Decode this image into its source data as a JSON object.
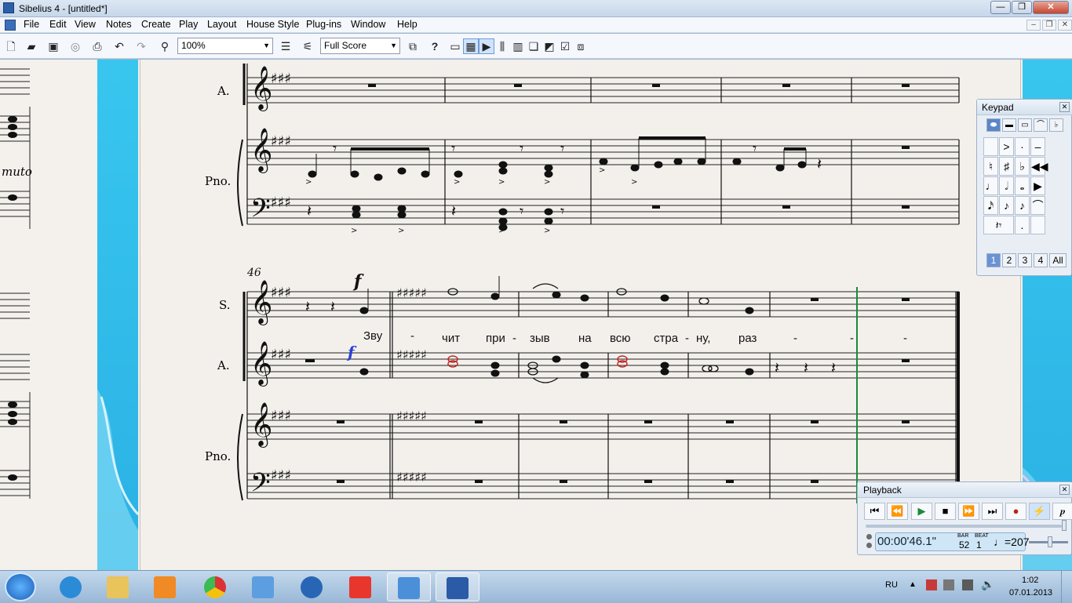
{
  "window": {
    "title": "Sibelius 4 - [untitled*]",
    "min": "—",
    "max": "❐",
    "close": "✕"
  },
  "menu": [
    "File",
    "Edit",
    "View",
    "Notes",
    "Create",
    "Play",
    "Layout",
    "House Style",
    "Plug-ins",
    "Window",
    "Help"
  ],
  "mdi": {
    "min": "–",
    "restore": "❐",
    "close": "✕"
  },
  "toolbar": {
    "zoom": "100%",
    "score_view": "Full Score",
    "help": "?"
  },
  "score": {
    "bar_number": "46",
    "staff_names": {
      "s": "S.",
      "a1": "A.",
      "a2": "A.",
      "pno1": "Pno.",
      "pno2": "Pno."
    },
    "dynamic_s": "f",
    "dynamic_a": "f",
    "left_page_text": "muto",
    "lyrics": [
      "Зву",
      "-",
      "чит",
      "при",
      "-",
      "зыв",
      "на",
      "всю",
      "стра",
      "-",
      "ну,",
      "раз",
      "-",
      "-",
      "-"
    ]
  },
  "keypad": {
    "title": "Keypad",
    "close": "✕",
    "layouts": [
      "1",
      "2",
      "3",
      "4",
      "All"
    ],
    "active_layout": "1"
  },
  "playback": {
    "title": "Playback",
    "close": "✕",
    "time": "00:00'46.1\"",
    "bar_label": "BAR",
    "bar": "52",
    "beat_label": "BEAT",
    "beat": "1",
    "tempo": "♩=207"
  },
  "tray": {
    "lang": "RU",
    "time": "1:02",
    "date": "07.01.2013"
  },
  "colors": {
    "accent_blue": "#2ab1e4",
    "playline_green": "#1a8a3a",
    "selection_blue": "#2a3fd6",
    "red_note": "#c0201a"
  }
}
